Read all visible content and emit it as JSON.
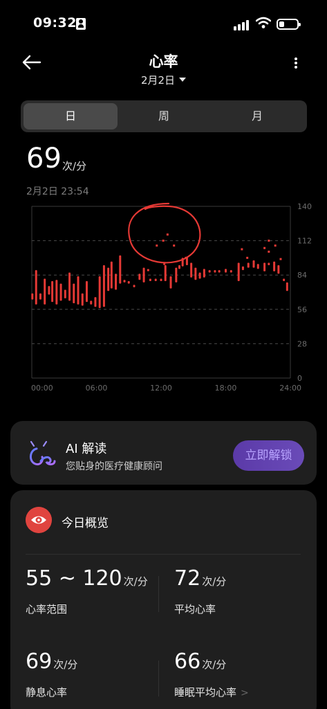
{
  "status_bar": {
    "time": "09:32"
  },
  "header": {
    "title": "心率",
    "date": "2月2日"
  },
  "tabs": [
    {
      "label": "日",
      "active": true
    },
    {
      "label": "周",
      "active": false
    },
    {
      "label": "月",
      "active": false
    }
  ],
  "current": {
    "value": "69",
    "unit": "次/分",
    "timestamp": "2月2日 23:54"
  },
  "chart_data": {
    "type": "bar",
    "y_ticks": [
      "140",
      "112",
      "84",
      "56",
      "28",
      "0"
    ],
    "x_ticks": [
      "00:00",
      "06:00",
      "12:00",
      "18:00",
      "24:00"
    ],
    "ylim": [
      0,
      140
    ],
    "xlim": [
      0,
      24
    ],
    "grid": true,
    "color": "#e53935",
    "ranges": [
      {
        "t": 0.05,
        "lo": 64,
        "hi": 69
      },
      {
        "t": 0.4,
        "lo": 60,
        "hi": 88
      },
      {
        "t": 0.8,
        "lo": 64,
        "hi": 69
      },
      {
        "t": 1.2,
        "lo": 60,
        "hi": 81
      },
      {
        "t": 1.6,
        "lo": 68,
        "hi": 75
      },
      {
        "t": 1.9,
        "lo": 62,
        "hi": 79
      },
      {
        "t": 2.3,
        "lo": 60,
        "hi": 80
      },
      {
        "t": 2.7,
        "lo": 63,
        "hi": 77
      },
      {
        "t": 3.1,
        "lo": 65,
        "hi": 72
      },
      {
        "t": 3.5,
        "lo": 63,
        "hi": 86
      },
      {
        "t": 3.9,
        "lo": 61,
        "hi": 77
      },
      {
        "t": 4.3,
        "lo": 60,
        "hi": 83
      },
      {
        "t": 4.7,
        "lo": 59,
        "hi": 69
      },
      {
        "t": 5.1,
        "lo": 62,
        "hi": 79
      },
      {
        "t": 5.5,
        "lo": 60,
        "hi": 63
      },
      {
        "t": 5.9,
        "lo": 58,
        "hi": 66
      },
      {
        "t": 6.3,
        "lo": 57,
        "hi": 83
      },
      {
        "t": 6.7,
        "lo": 58,
        "hi": 92
      },
      {
        "t": 7.1,
        "lo": 71,
        "hi": 90
      },
      {
        "t": 7.4,
        "lo": 73,
        "hi": 95
      },
      {
        "t": 7.8,
        "lo": 72,
        "hi": 85
      },
      {
        "t": 8.2,
        "lo": 77,
        "hi": 100
      },
      {
        "t": 8.6,
        "lo": 78,
        "hi": 80
      },
      {
        "t": 9.0,
        "lo": 77,
        "hi": 79
      },
      {
        "t": 9.5,
        "lo": 74,
        "hi": 76
      },
      {
        "t": 10.0,
        "lo": 80,
        "hi": 85
      },
      {
        "t": 10.4,
        "lo": 78,
        "hi": 90
      },
      {
        "t": 11.0,
        "lo": 79,
        "hi": 81
      },
      {
        "t": 11.5,
        "lo": 79,
        "hi": 81
      },
      {
        "t": 12.0,
        "lo": 79,
        "hi": 81
      },
      {
        "t": 12.4,
        "lo": 79,
        "hi": 92
      },
      {
        "t": 12.9,
        "lo": 73,
        "hi": 83
      },
      {
        "t": 13.4,
        "lo": 78,
        "hi": 90
      },
      {
        "t": 13.7,
        "lo": 89,
        "hi": 92
      },
      {
        "t": 14.0,
        "lo": 91,
        "hi": 98
      },
      {
        "t": 14.4,
        "lo": 92,
        "hi": 99
      },
      {
        "t": 14.8,
        "lo": 82,
        "hi": 94
      },
      {
        "t": 15.2,
        "lo": 80,
        "hi": 90
      },
      {
        "t": 15.6,
        "lo": 81,
        "hi": 86
      },
      {
        "t": 16.0,
        "lo": 82,
        "hi": 89
      },
      {
        "t": 16.5,
        "lo": 86,
        "hi": 88
      },
      {
        "t": 17.0,
        "lo": 86,
        "hi": 88
      },
      {
        "t": 17.4,
        "lo": 86,
        "hi": 88
      },
      {
        "t": 18.0,
        "lo": 86,
        "hi": 89
      },
      {
        "t": 18.5,
        "lo": 86,
        "hi": 88
      },
      {
        "t": 19.2,
        "lo": 79,
        "hi": 94
      },
      {
        "t": 19.6,
        "lo": 88,
        "hi": 91
      },
      {
        "t": 20.1,
        "lo": 90,
        "hi": 94
      },
      {
        "t": 20.6,
        "lo": 90,
        "hi": 96
      },
      {
        "t": 21.0,
        "lo": 89,
        "hi": 93
      },
      {
        "t": 21.6,
        "lo": 87,
        "hi": 94
      },
      {
        "t": 22.0,
        "lo": 92,
        "hi": 94
      },
      {
        "t": 22.5,
        "lo": 87,
        "hi": 95
      },
      {
        "t": 22.9,
        "lo": 85,
        "hi": 92
      },
      {
        "t": 23.4,
        "lo": 79,
        "hi": 81
      },
      {
        "t": 23.7,
        "lo": 71,
        "hi": 78
      }
    ],
    "points": [
      {
        "t": 10.8,
        "v": 88
      },
      {
        "t": 11.6,
        "v": 108
      },
      {
        "t": 12.2,
        "v": 112
      },
      {
        "t": 12.6,
        "v": 117
      },
      {
        "t": 12.3,
        "v": 93
      },
      {
        "t": 13.2,
        "v": 108
      },
      {
        "t": 14.3,
        "v": 98
      },
      {
        "t": 19.5,
        "v": 105
      },
      {
        "t": 20.0,
        "v": 98
      },
      {
        "t": 21.6,
        "v": 106
      },
      {
        "t": 22.0,
        "v": 112
      },
      {
        "t": 22.6,
        "v": 108
      },
      {
        "t": 22.0,
        "v": 103
      },
      {
        "t": 23.1,
        "v": 97
      }
    ]
  },
  "ai": {
    "title": "AI 解读",
    "subtitle": "您贴身的医疗健康顾问",
    "button": "立即解锁"
  },
  "overview": {
    "title": "今日概览",
    "stats": [
      {
        "value": "55 ~ 120",
        "unit": "次/分",
        "label": "心率范围"
      },
      {
        "value": "72",
        "unit": "次/分",
        "label": "平均心率"
      },
      {
        "value": "69",
        "unit": "次/分",
        "label": "静息心率"
      },
      {
        "value": "66",
        "unit": "次/分",
        "label": "睡眠平均心率"
      }
    ]
  },
  "colors": {
    "accent": "#e53935",
    "ai_button": "#5b3aa8",
    "card": "#1f1f1f"
  }
}
